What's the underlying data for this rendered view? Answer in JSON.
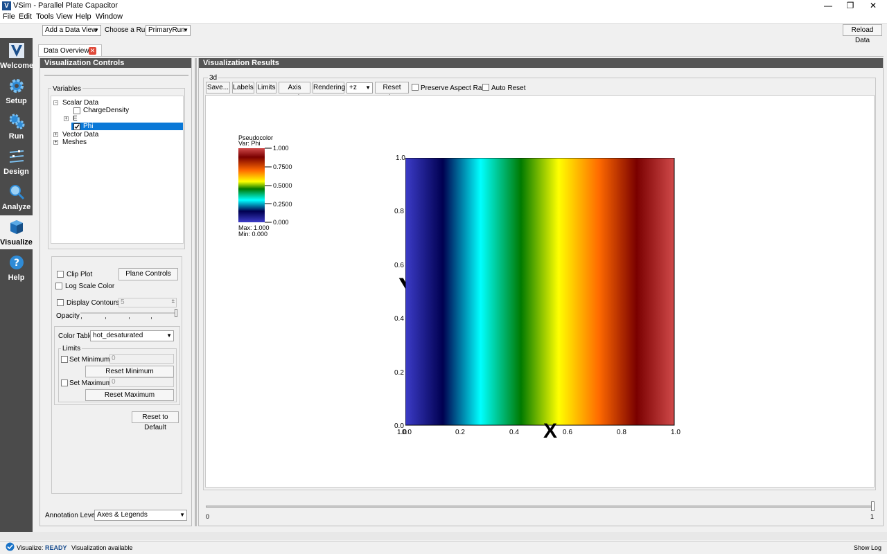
{
  "window": {
    "title": "VSim - Parallel Plate Capacitor",
    "logo_letter": "V"
  },
  "menu": [
    "File",
    "Edit",
    "Tools",
    "View",
    "Help",
    "Window"
  ],
  "toolbar": {
    "data_view": "Add a Data View",
    "run_label": "Choose a Run:",
    "run_value": "PrimaryRun",
    "reload": "Reload Data"
  },
  "sidebar": [
    {
      "label": "Welcome",
      "icon": "vsim-logo-icon"
    },
    {
      "label": "Setup",
      "icon": "gear-icon"
    },
    {
      "label": "Run",
      "icon": "gears-icon"
    },
    {
      "label": "Design",
      "icon": "design-icon"
    },
    {
      "label": "Analyze",
      "icon": "magnifier-icon"
    },
    {
      "label": "Visualize",
      "icon": "cube-icon"
    },
    {
      "label": "Help",
      "icon": "help-icon"
    }
  ],
  "tab": {
    "label": "Data Overview1"
  },
  "controls": {
    "header": "Visualization Controls",
    "variables_title": "Variables",
    "tree": {
      "scalar": "Scalar Data",
      "charge": "ChargeDensity",
      "e": "E",
      "phi": "Phi",
      "vector": "Vector Data",
      "meshes": "Meshes"
    },
    "clip_plot": "Clip Plot",
    "plane_controls": "Plane Controls",
    "log_scale": "Log Scale Color",
    "display_contours": "Display Contours",
    "contours_value": "5",
    "opacity": "Opacity",
    "color_table_label": "Color Table",
    "color_table_value": "hot_desaturated",
    "limits_title": "Limits",
    "set_min": "Set Minimum",
    "min_value": "0",
    "reset_min": "Reset Minimum",
    "set_max": "Set Maximum",
    "max_value": "0",
    "reset_max": "Reset Maximum",
    "reset_default": "Reset to Default",
    "annotation_label": "Annotation Level:",
    "annotation_value": "Axes & Legends"
  },
  "results": {
    "header": "Visualization Results",
    "group_label": "3d",
    "buttons": {
      "save": "Save...",
      "labels": "Labels",
      "limits": "Limits",
      "axis_scale": "Axis Scale",
      "rendering": "Rendering",
      "view_dir": "+z",
      "reset_view": "Reset View"
    },
    "preserve_aspect": "Preserve Aspect Ratio",
    "auto_reset": "Auto Reset",
    "slider_min": "0",
    "slider_max": "1"
  },
  "legend": {
    "title": "Pseudocolor",
    "var": "Var: Phi",
    "ticks": [
      "1.000",
      "0.7500",
      "0.5000",
      "0.2500",
      "0.000"
    ],
    "max": "Max:  1.000",
    "min": "Min:  0.000"
  },
  "chart_data": {
    "type": "heatmap",
    "title": "",
    "xlabel": "X",
    "ylabel": "Y",
    "xlim": [
      0.0,
      1.0
    ],
    "ylim": [
      0.0,
      1.0
    ],
    "x_ticks": [
      "0.0",
      "0.2",
      "0.4",
      "0.6",
      "0.8",
      "1.0"
    ],
    "y_ticks": [
      "0.0",
      "0.2",
      "0.4",
      "0.6",
      "0.8",
      "1.0"
    ],
    "x_start_label": "1.0",
    "colormap": "hot_desaturated",
    "value_range": [
      0.0,
      1.0
    ],
    "field": "Phi varies linearly with x from 0 at x=0 to 1 at x=1, constant in y"
  },
  "status": {
    "mode": "Visualize:",
    "state": "READY",
    "message": "Visualization available",
    "show_log": "Show Log"
  }
}
